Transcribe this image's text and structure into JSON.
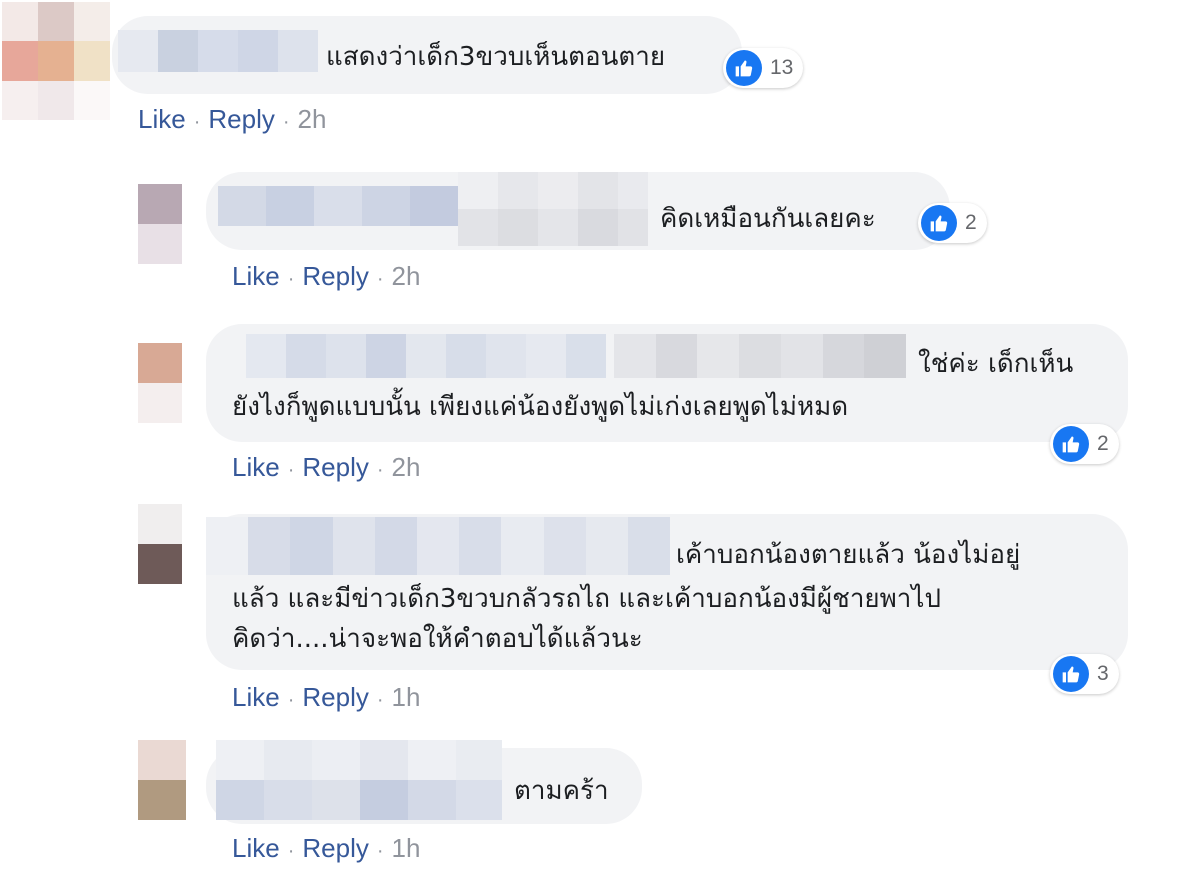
{
  "comments": [
    {
      "text_lines": [
        "แสดงว่าเด็ก3ขวบเห็นตอนตาย"
      ],
      "reaction_count": "13",
      "like_label": "Like",
      "reply_label": "Reply",
      "time": "2h"
    },
    {
      "text_lines": [
        "คิดเหมือนกันเลยคะ"
      ],
      "reaction_count": "2",
      "like_label": "Like",
      "reply_label": "Reply",
      "time": "2h"
    },
    {
      "text_lines": [
        "ใช่ค่ะ เด็กเห็น",
        "ยังไงก็พูดแบบนั้น เพียงแค่น้องยังพูดไม่เก่งเลยพูดไม่หมด"
      ],
      "reaction_count": "2",
      "like_label": "Like",
      "reply_label": "Reply",
      "time": "2h"
    },
    {
      "text_lines": [
        "เค้าบอกน้องตายแล้ว น้องไม่อยู่",
        "แล้ว และมีข่าวเด็ก3ขวบกลัวรถไถ และเค้าบอกน้องมีผู้ชายพาไป",
        "คิดว่า....น่าจะพอให้คำตอบได้แล้วนะ"
      ],
      "reaction_count": "3",
      "like_label": "Like",
      "reply_label": "Reply",
      "time": "1h"
    },
    {
      "text_lines": [
        "ตามคร้า"
      ],
      "like_label": "Like",
      "reply_label": "Reply",
      "time": "1h"
    }
  ],
  "colors": {
    "like_blue": "#1877f2",
    "link": "#365899",
    "meta": "#90949c",
    "bubble": "#f2f3f5"
  },
  "icons": {
    "reaction": "thumbs-up-icon"
  }
}
